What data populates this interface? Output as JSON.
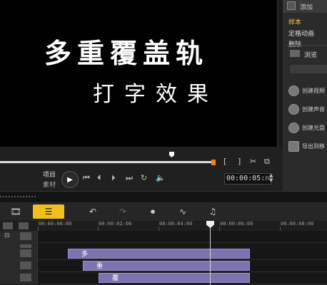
{
  "preview": {
    "overlay_line1": "多重覆盖轨",
    "overlay_line2": "打字效果"
  },
  "right_panel": {
    "top_label": "添加",
    "items": [
      "样本",
      "定格动画",
      "删除"
    ],
    "browse_label": "浏览",
    "actions": [
      "创建视频",
      "创建声音",
      "创建光盘",
      "导出到移"
    ]
  },
  "playback": {
    "mode_project": "项目",
    "mode_clip": "素材",
    "timecode": "00:00:05:",
    "timecode_frame": "n",
    "bracket_in": "[",
    "bracket_out": "]"
  },
  "ruler": {
    "ticks": [
      "00:00:00:00",
      "00:00:02:00",
      "00:00:04:00",
      "00:00:06:00",
      "00:00:08:00"
    ]
  },
  "tracks": {
    "clips": [
      "多",
      "重",
      "覆"
    ]
  },
  "colors": {
    "accent": "#f0c020",
    "clip": "#7c74b0",
    "scrub_end": "#f08020"
  }
}
